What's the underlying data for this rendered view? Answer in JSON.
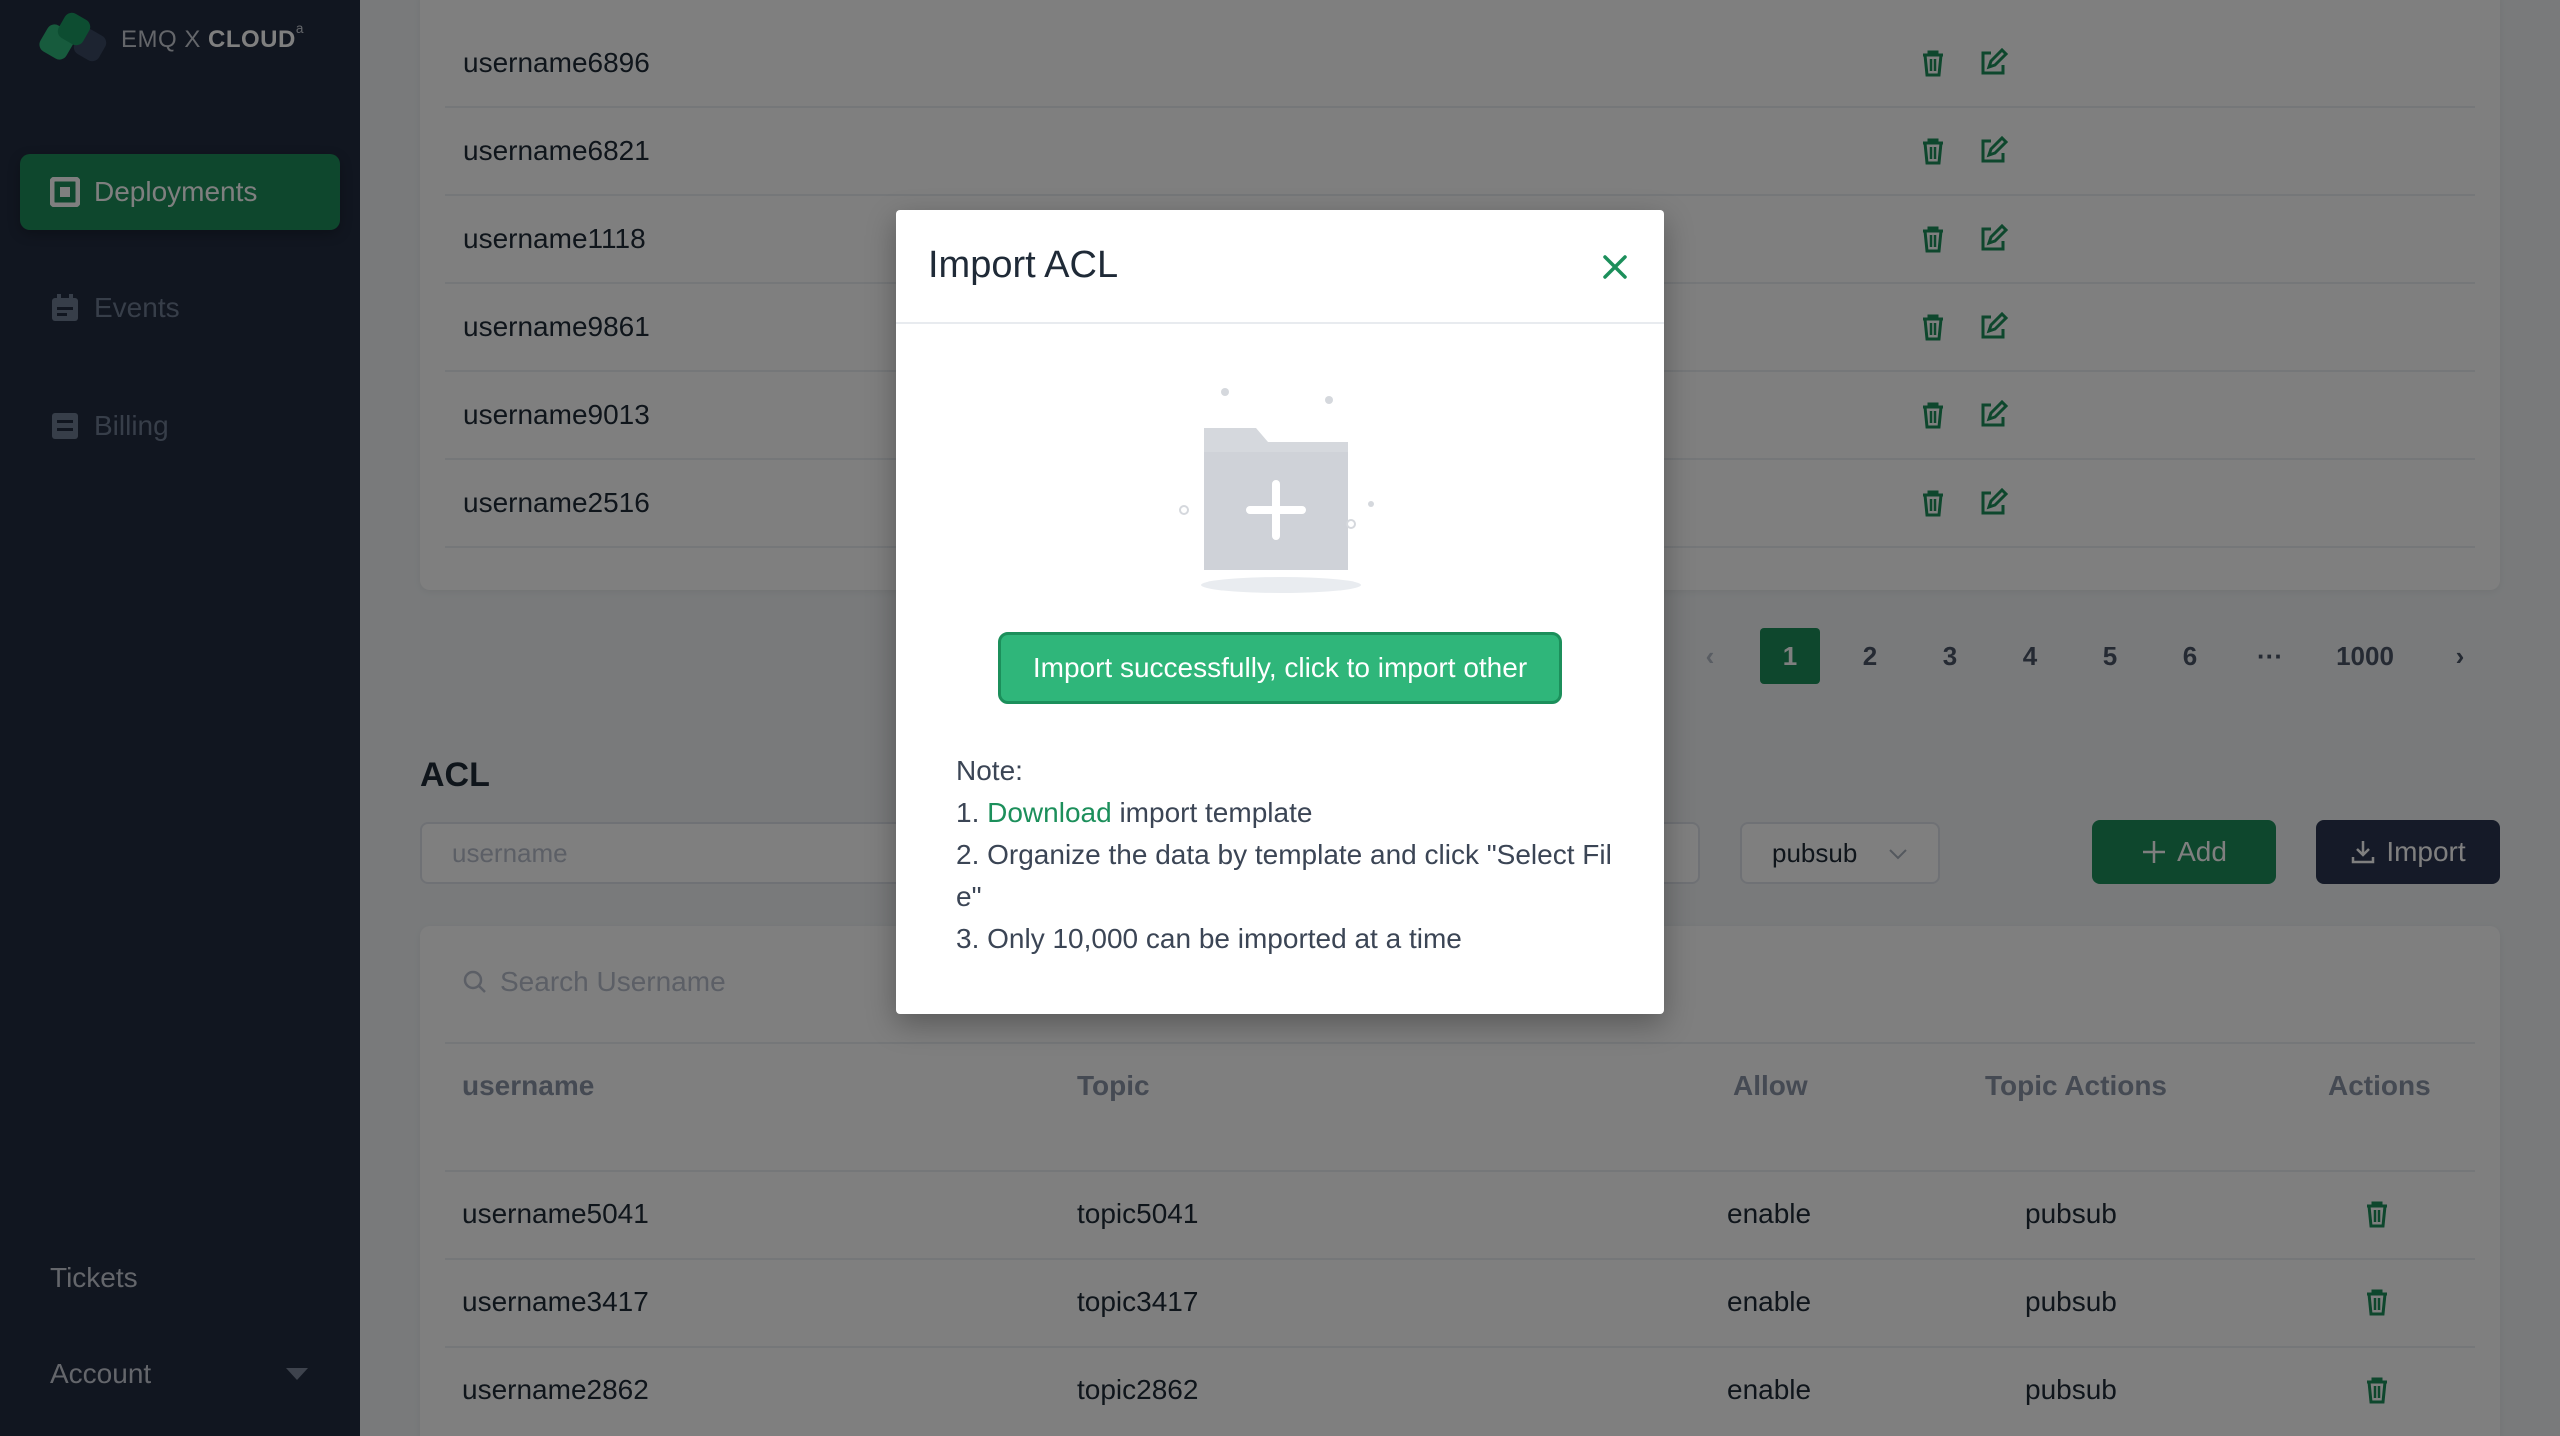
{
  "brand": {
    "name_light": "EMQ X",
    "name_bold": "CLOUD",
    "sup": "ᵃ"
  },
  "sidebar": {
    "items": [
      {
        "label": "Deployments",
        "icon": "deployments-icon"
      },
      {
        "label": "Events",
        "icon": "events-icon"
      },
      {
        "label": "Billing",
        "icon": "billing-icon"
      }
    ],
    "bottom": {
      "tickets": "Tickets",
      "account": "Account"
    }
  },
  "auth_table": {
    "rows": [
      {
        "username": "username6896"
      },
      {
        "username": "username6821"
      },
      {
        "username": "username1118"
      },
      {
        "username": "username9861"
      },
      {
        "username": "username9013"
      },
      {
        "username": "username2516"
      }
    ]
  },
  "pagination": {
    "prev": "‹",
    "pages": [
      "1",
      "2",
      "3",
      "4",
      "5",
      "6",
      "···",
      "1000"
    ],
    "current": "1",
    "next": "›"
  },
  "acl": {
    "title": "ACL",
    "username_placeholder": "username",
    "action_select": "pubsub",
    "add_label": "Add",
    "import_label": "Import",
    "search_placeholder": "Search Username",
    "columns": [
      "username",
      "Topic",
      "Allow",
      "Topic Actions",
      "Actions"
    ],
    "rows": [
      {
        "username": "username5041",
        "topic": "topic5041",
        "allow": "enable",
        "action": "pubsub"
      },
      {
        "username": "username3417",
        "topic": "topic3417",
        "allow": "enable",
        "action": "pubsub"
      },
      {
        "username": "username2862",
        "topic": "topic2862",
        "allow": "enable",
        "action": "pubsub"
      }
    ]
  },
  "modal": {
    "title": "Import ACL",
    "success_button": "Import successfully, click to import other",
    "note_label": "Note:",
    "note1_prefix": "1. ",
    "note1_link": "Download",
    "note1_suffix": " import template",
    "note2": "2. Organize the data by template and click \"Select Fil e\"",
    "note3": "3. Only 10,000 can be imported at a time"
  },
  "colors": {
    "accent": "#1c8f5b",
    "accent_light": "#2fb67a",
    "sidebar_bg": "#222c40",
    "import_btn": "#2a3550"
  }
}
